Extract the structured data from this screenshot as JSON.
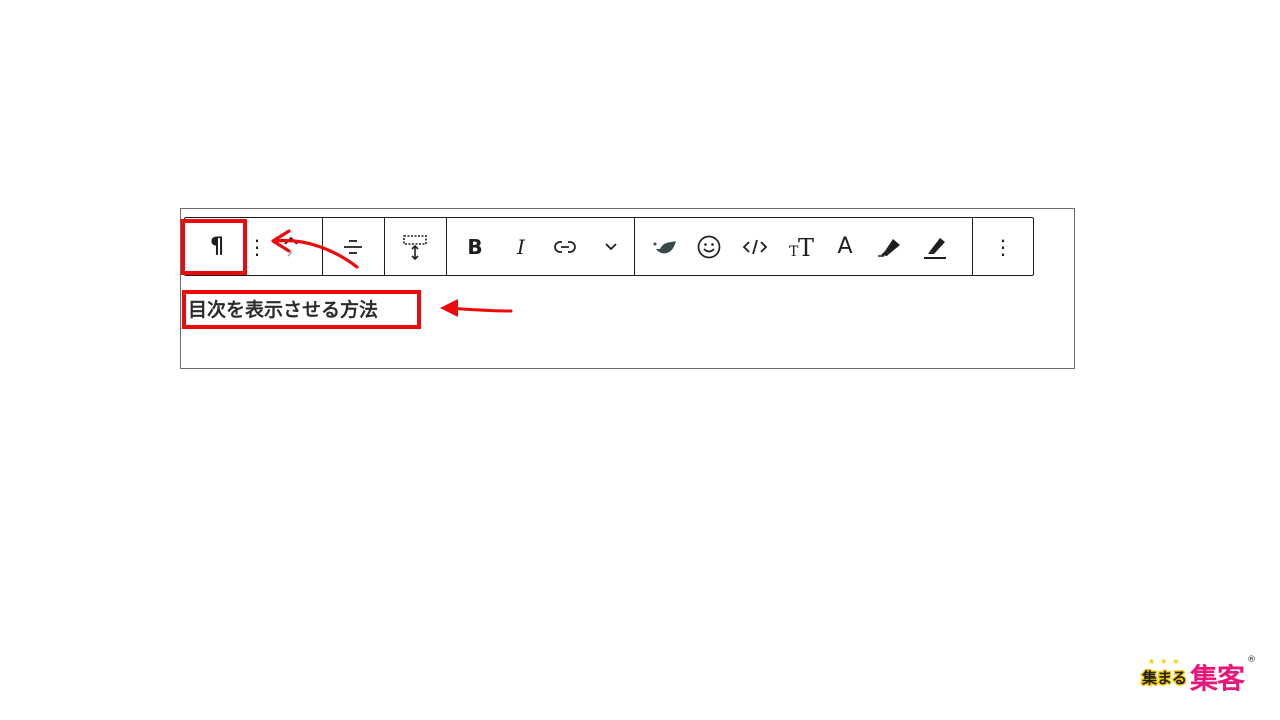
{
  "editor": {
    "heading_text": "目次を表示させる方法"
  },
  "toolbar": {
    "paragraph_glyph": "¶",
    "drag_glyph": "⋮",
    "more_glyph": "⋮",
    "bold_label": "B",
    "italic_label": "I",
    "font_size_label": "TT",
    "text_color_label": "A"
  },
  "logo": {
    "small_text": "集まる",
    "big_text": "集客",
    "registered": "®",
    "stars": "★★★"
  },
  "colors": {
    "annotation_red": "#ee0a0a",
    "toolbar_border": "#1e1e1e",
    "logo_pink": "#e8157a",
    "logo_yellow": "#f6c800"
  }
}
